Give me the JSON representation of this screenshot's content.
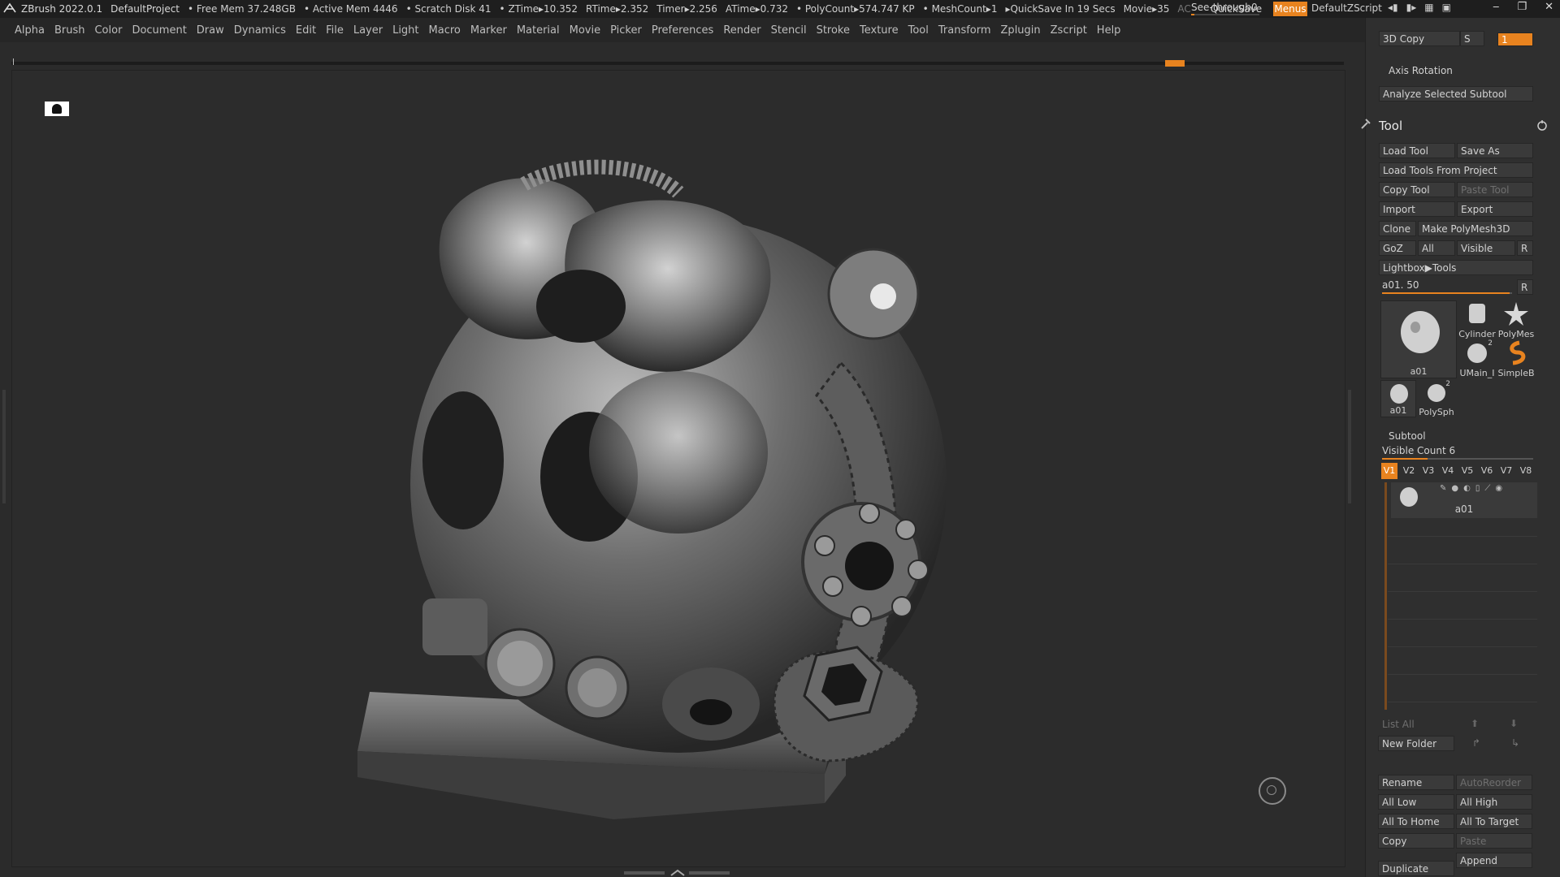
{
  "titlebar": {
    "app": "ZBrush 2022.0.1",
    "project": "DefaultProject",
    "free_mem": "• Free Mem 37.248GB",
    "active_mem": "• Active Mem 4446",
    "scratch": "• Scratch Disk 41",
    "ztime": "• ZTime▸10.352",
    "rtime": "RTime▸2.352",
    "timer": "Timer▸2.256",
    "atime": "ATime▸0.732",
    "polycount": "• PolyCount▸574.747 KP",
    "meshcount": "• MeshCount▸1",
    "quicksave_in": "▸QuickSave In 19 Secs",
    "movie": "Movie▸35",
    "ac": "AC",
    "quicksave": "QuickSave",
    "see_through_label": "See-through",
    "see_through_value": "0",
    "see_through_level": 0.0,
    "menus": "Menus",
    "default_zscript": "DefaultZScript"
  },
  "menu": [
    "Alpha",
    "Brush",
    "Color",
    "Document",
    "Draw",
    "Dynamics",
    "Edit",
    "File",
    "Layer",
    "Light",
    "Macro",
    "Marker",
    "Material",
    "Movie",
    "Picker",
    "Preferences",
    "Render",
    "Stencil",
    "Stroke",
    "Texture",
    "Tool",
    "Transform",
    "Zplugin",
    "Zscript",
    "Help"
  ],
  "panel": {
    "copy3d": "3D Copy",
    "copy3d_s": "S",
    "copy3d_val": "1",
    "axis_rotation": "Axis Rotation",
    "analyze": "Analyze Selected Subtool",
    "tool_title": "Tool",
    "load_tool": "Load Tool",
    "save_as": "Save As",
    "load_from_project": "Load Tools From Project",
    "copy_tool": "Copy Tool",
    "paste_tool": "Paste Tool",
    "import": "Import",
    "export": "Export",
    "clone": "Clone",
    "make_polymesh": "Make PolyMesh3D",
    "goz": "GoZ",
    "all": "All",
    "visible": "Visible",
    "r": "R",
    "lightbox_tools": "Lightbox▶Tools",
    "tool_name_value": "a01. 50",
    "tool_slider_level": 0.98,
    "r2": "R",
    "thumb_main_cap": "a01",
    "thumb_cylinder": "Cylinder",
    "thumb_polymesh": "PolyMes",
    "thumb_umain": "UMain_I",
    "umain_badge": "2",
    "thumb_simpleb": "SimpleB",
    "thumb_small_a01": "a01",
    "thumb_polysph": "PolySph",
    "polysph_badge": "2",
    "subtool_title": "Subtool",
    "visible_count": "Visible Count 6",
    "visible_count_level": 0.3,
    "vtabs": [
      "V1",
      "V2",
      "V3",
      "V4",
      "V5",
      "V6",
      "V7",
      "V8"
    ],
    "subtool_item": "a01",
    "list_all": "List All",
    "new_folder": "New Folder",
    "rename": "Rename",
    "autoreorder": "AutoReorder",
    "all_low": "All Low",
    "all_high": "All High",
    "all_to_home": "All To Home",
    "all_to_target": "All To Target",
    "copy": "Copy",
    "paste": "Paste",
    "append": "Append",
    "duplicate": "Duplicate"
  },
  "colors": {
    "accent": "#e8831f",
    "bg": "#2b2b2b",
    "panel": "#2f2f2f"
  }
}
